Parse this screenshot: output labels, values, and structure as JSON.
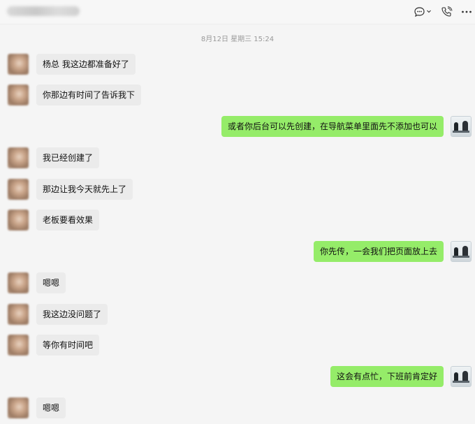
{
  "header": {
    "title": "•••••••••• ••••",
    "chat_icon": "chat-bubble-icon",
    "call_icon": "phone-call-icon",
    "more_icon": "more-dots-icon"
  },
  "timestamp": "8月12日 星期三 15:24",
  "messages": [
    {
      "side": "left",
      "text": "杨总 我这边都准备好了"
    },
    {
      "side": "left",
      "text": "你那边有时间了告诉我下"
    },
    {
      "side": "right",
      "text": "或者你后台可以先创建，在导航菜单里面先不添加也可以"
    },
    {
      "side": "left",
      "text": "我已经创建了"
    },
    {
      "side": "left",
      "text": "那边让我今天就先上了"
    },
    {
      "side": "left",
      "text": "老板要看效果"
    },
    {
      "side": "right",
      "text": "你先传，一会我们把页面放上去"
    },
    {
      "side": "left",
      "text": "嗯嗯"
    },
    {
      "side": "left",
      "text": "我这边没问题了"
    },
    {
      "side": "left",
      "text": "等你有时间吧"
    },
    {
      "side": "right",
      "text": "这会有点忙，下班前肯定好"
    },
    {
      "side": "left",
      "text": "嗯嗯"
    }
  ],
  "colors": {
    "outgoing_bubble": "#95ec69",
    "incoming_bubble": "#ebebeb",
    "background": "#f5f5f5"
  }
}
